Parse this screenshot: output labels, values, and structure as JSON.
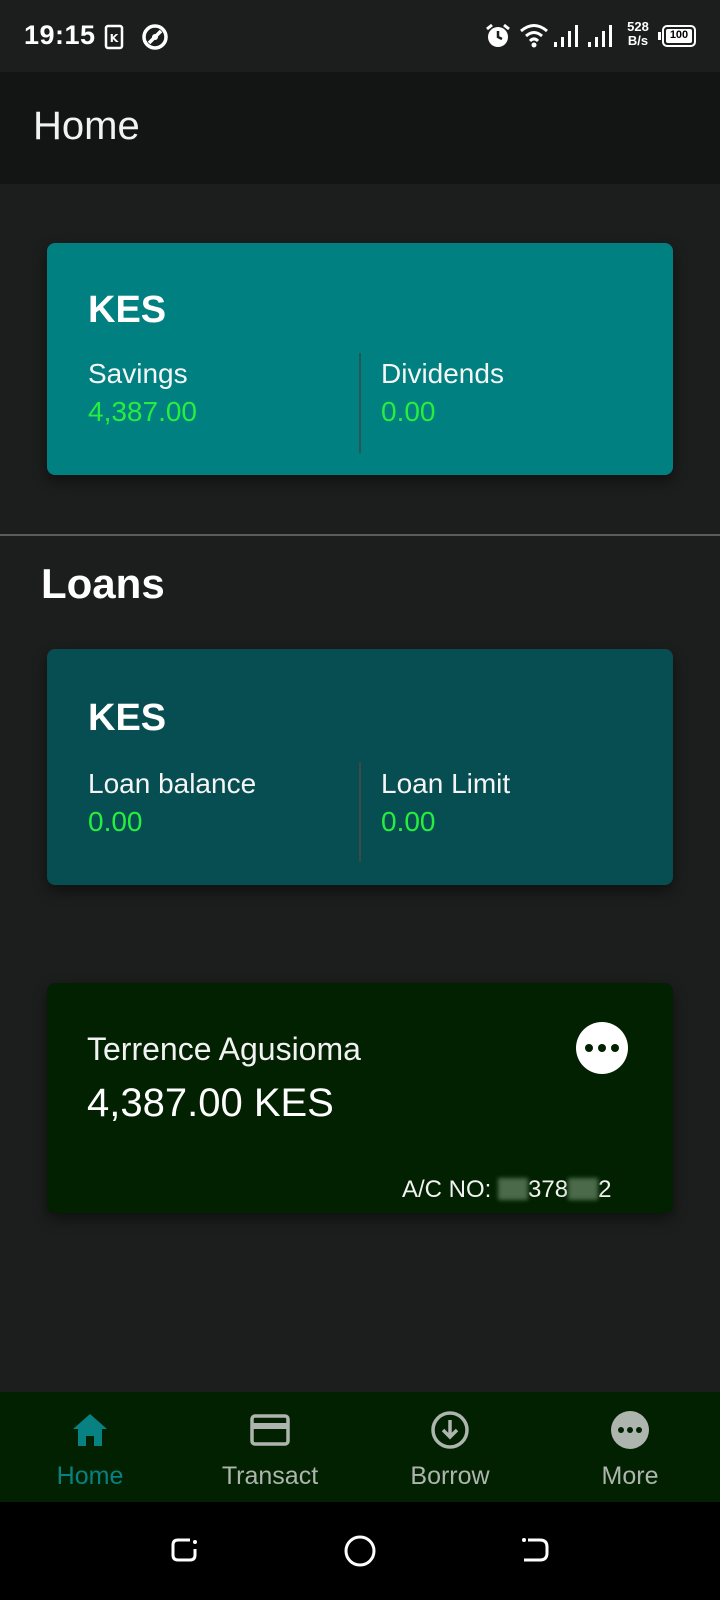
{
  "status_bar": {
    "time": "19:15",
    "net_speed_value": "528",
    "net_speed_unit": "B/s",
    "battery": "100",
    "icons": [
      "sim-card-icon",
      "vpn-icon",
      "alarm-icon",
      "wifi-icon",
      "signal-icon",
      "signal-icon",
      "battery-icon"
    ]
  },
  "app_bar": {
    "title": "Home"
  },
  "savings_card": {
    "currency": "KES",
    "left_label": "Savings",
    "left_value": "4,387.00",
    "right_label": "Dividends",
    "right_value": "0.00"
  },
  "loans_section": {
    "title": "Loans"
  },
  "loans_card": {
    "currency": "KES",
    "left_label": "Loan balance",
    "left_value": "0.00",
    "right_label": "Loan Limit",
    "right_value": "0.00"
  },
  "account_card": {
    "name": "Terrence Agusioma",
    "balance": "4,387.00 KES",
    "acct_prefix": "A/C NO: ",
    "acct_mid": "378",
    "acct_end": "2",
    "menu_icon": "more-horizontal-icon"
  },
  "bottom_nav": {
    "items": [
      {
        "label": "Home",
        "icon": "home-icon",
        "active": true
      },
      {
        "label": "Transact",
        "icon": "card-icon",
        "active": false
      },
      {
        "label": "Borrow",
        "icon": "download-circle-icon",
        "active": false
      },
      {
        "label": "More",
        "icon": "more-circle-icon",
        "active": false
      }
    ]
  },
  "colors": {
    "background": "#1c1d1d",
    "app_bar": "#131414",
    "savings_card": "#008080",
    "loans_card": "#064e51",
    "account_card": "#012100",
    "value_green": "#25ee3f",
    "nav_active": "#078181",
    "nav_inactive": "#aeb4ae"
  }
}
